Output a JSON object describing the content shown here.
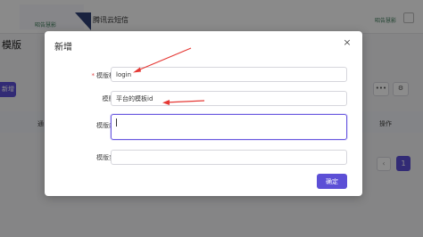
{
  "background": {
    "logo_text": "昭告慧影",
    "app_name": "腾讯云短信",
    "top_right_text": "昭告慧影",
    "page_title": "模版",
    "add_button_label": "新增",
    "more_icon": "ellipsis-icon",
    "table_columns": [
      "通",
      "操作"
    ],
    "pager_prev": "‹",
    "pager_current": "1"
  },
  "modal": {
    "title": "新增",
    "close_icon": "×",
    "fields": [
      {
        "label": "模版标识",
        "required": true,
        "value": "login",
        "type": "input"
      },
      {
        "label": "模版ID",
        "required": false,
        "value": "平台的模板id",
        "type": "input"
      },
      {
        "label": "模版内容",
        "required": false,
        "value": "",
        "type": "textarea"
      },
      {
        "label": "模版变量",
        "required": false,
        "value": "",
        "type": "input"
      }
    ],
    "confirm_label": "确定"
  },
  "colors": {
    "primary": "#5c4fd6",
    "annotation_arrow": "#e53935",
    "required_mark": "#e04848"
  }
}
